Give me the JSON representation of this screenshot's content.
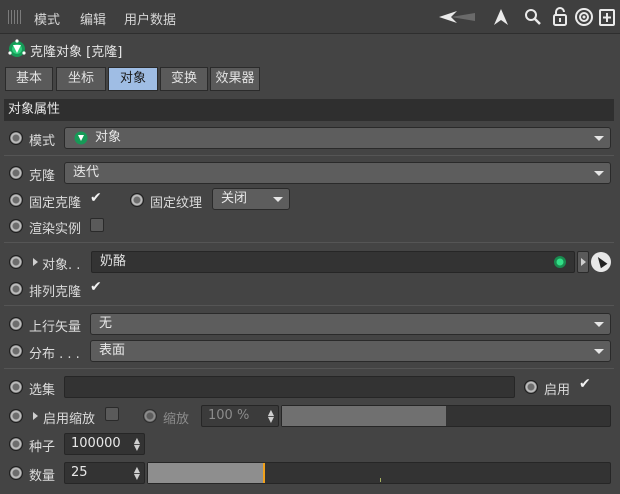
{
  "menubar": {
    "items": [
      "模式",
      "编辑",
      "用户数据"
    ],
    "icons": [
      "back-arrow-icon",
      "up-arrow-icon",
      "search-icon",
      "lock-icon",
      "target-icon",
      "new-window-icon"
    ]
  },
  "object": {
    "title": "克隆对象 [克隆]",
    "icon": "cloner-icon"
  },
  "tabs": [
    {
      "label": "基本",
      "active": false
    },
    {
      "label": "坐标",
      "active": false
    },
    {
      "label": "对象",
      "active": true
    },
    {
      "label": "变换",
      "active": false
    },
    {
      "label": "效果器",
      "active": false
    }
  ],
  "section": {
    "title": "对象属性"
  },
  "mode": {
    "label": "模式",
    "value": "对象"
  },
  "clone": {
    "label": "克隆",
    "value": "迭代"
  },
  "fixed_clone": {
    "label": "固定克隆",
    "checked": true
  },
  "fixed_texture": {
    "label": "固定纹理",
    "value": "关闭"
  },
  "render_instances": {
    "label": "渲染实例",
    "checked": false
  },
  "object_link": {
    "label": "对象. .",
    "value": "奶酪"
  },
  "arrange_clones": {
    "label": "排列克隆",
    "checked": true
  },
  "up_vector": {
    "label": "上行矢量",
    "value": "无"
  },
  "distribution": {
    "label": "分布 . . .",
    "value": "表面"
  },
  "selection": {
    "label": "选集",
    "value": "",
    "enable_label": "启用",
    "enabled": true
  },
  "enable_scale": {
    "label": "启用缩放",
    "checked": false
  },
  "scale": {
    "label": "缩放",
    "value": "100 %",
    "fill": 0.5
  },
  "seed": {
    "label": "种子",
    "value": "100000"
  },
  "count": {
    "label": "数量",
    "value": "25",
    "fill": 0.25
  },
  "colors": {
    "accent": "#9fbde4",
    "background": "#444444",
    "knob": "#f0a11b"
  }
}
